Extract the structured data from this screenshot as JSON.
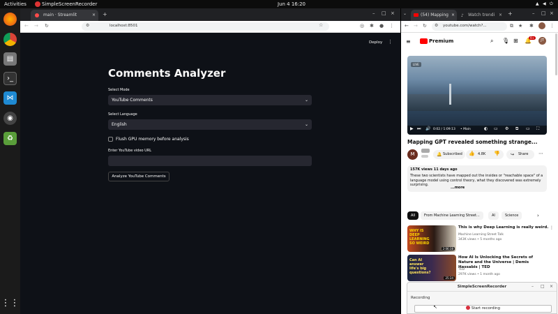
{
  "topbar": {
    "activities": "Activities",
    "app_name": "SimpleScreenRecorder",
    "clock": "Jun 4  16:20"
  },
  "left_browser": {
    "tab_title": "main · Streamlit",
    "url": "localhost:8501",
    "deploy_label": "Deploy"
  },
  "app": {
    "title": "Comments Analyzer",
    "mode_label": "Select Mode",
    "mode_value": "YouTube Comments",
    "language_label": "Select Language",
    "language_value": "English",
    "flush_label": "Flush GPU memory before analysis",
    "url_label": "Enter YouTube video URL",
    "url_value": "",
    "analyze_button": "Analyze YouTube Comments"
  },
  "right_browser": {
    "tab1_title": "(54) Mapping",
    "tab2_title": "Watch trendi",
    "url": "youtube.com/watch?...",
    "logo_text": "Premium",
    "notif_count": "9+",
    "avatar_initials": "JT",
    "video_time": "0:02 / 1:09:13",
    "video_chapter": "• Main",
    "video_title": "Mapping GPT revealed something strange...",
    "channel_initial": "M",
    "subscribed_label": "Subscribed",
    "likes": "4.8K",
    "share_label": "Share",
    "views_line": "157K views  11 days ago",
    "description": "These two scientists have mapped out the insides or \"reachable space\" of a language model using control theory, what they discovered was extremely surprising.",
    "more_label": "...more",
    "chips": [
      "All",
      "From Machine Learning Street...",
      "AI",
      "Science"
    ],
    "videos": [
      {
        "title": "This is why Deep Learning is really weird.",
        "channel": "Machine Learning Street Talk",
        "meta": "343K views • 5 months ago",
        "duration": "2:06:38",
        "thumb_text": "WHY IS DEEP LEARNING SO WEIRD"
      },
      {
        "title": "How AI Is Unlocking the Secrets of Nature and the Universe | Demis Hassabis | TED",
        "channel": "TED",
        "meta": "297K views • 1 month ago",
        "duration": "25:34",
        "thumb_text": "Can AI answer life's big questions?"
      }
    ]
  },
  "recorder": {
    "title": "SimpleScreenRecorder",
    "status": "Recording",
    "start_label": "Start recording"
  },
  "colors": {
    "streamlit_bg": "#0e1117",
    "youtube_red": "#ff0000"
  }
}
